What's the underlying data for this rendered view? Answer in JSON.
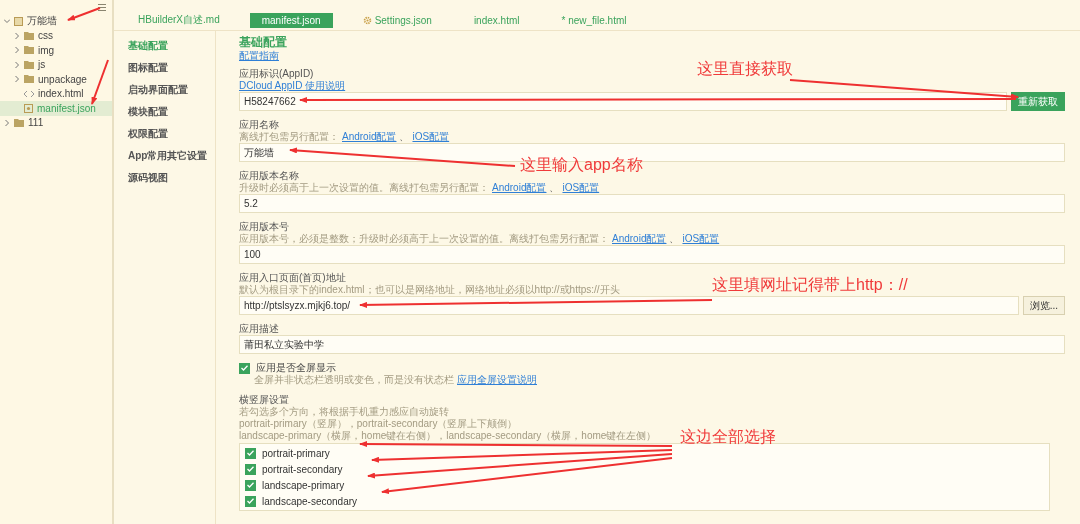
{
  "tree": [
    {
      "label": "万能墙",
      "kind": "project",
      "expanded": true,
      "selected": false,
      "children": [
        {
          "label": "css",
          "kind": "folder",
          "expanded": false,
          "selected": false
        },
        {
          "label": "img",
          "kind": "folder",
          "expanded": false,
          "selected": false
        },
        {
          "label": "js",
          "kind": "folder",
          "expanded": false,
          "selected": false
        },
        {
          "label": "unpackage",
          "kind": "folder",
          "expanded": false,
          "selected": false
        },
        {
          "label": "index.html",
          "kind": "html",
          "selected": false
        },
        {
          "label": "manifest.json",
          "kind": "json",
          "selected": true
        }
      ]
    },
    {
      "label": "111",
      "kind": "folder",
      "expanded": false,
      "selected": false
    }
  ],
  "tabs": [
    {
      "label": "HBuilderX自述.md",
      "selected": false,
      "kind": "file"
    },
    {
      "label": "manifest.json",
      "selected": true,
      "kind": "file"
    },
    {
      "label": "Settings.json",
      "selected": false,
      "kind": "settings"
    },
    {
      "label": "index.html",
      "selected": false,
      "kind": "file"
    },
    {
      "label": "* new_file.html",
      "selected": false,
      "kind": "file"
    }
  ],
  "menu": [
    {
      "label": "基础配置",
      "selected": true
    },
    {
      "label": "图标配置",
      "selected": false
    },
    {
      "label": "启动界面配置",
      "selected": false
    },
    {
      "label": "模块配置",
      "selected": false
    },
    {
      "label": "权限配置",
      "selected": false
    },
    {
      "label": "App常用其它设置",
      "selected": false
    },
    {
      "label": "源码视图",
      "selected": false
    }
  ],
  "section": {
    "title": "基础配置",
    "link": "配置指南"
  },
  "fields": [
    {
      "kind": "input",
      "label": "应用标识(AppID)",
      "links": [
        "DCloud AppID 使用说明"
      ],
      "value": "H58247662",
      "button": "重新获取"
    },
    {
      "kind": "input",
      "label": "应用名称",
      "hint": "离线打包需另行配置：",
      "links": [
        "Android配置",
        "iOS配置"
      ],
      "separator": "、",
      "value": "万能墙"
    },
    {
      "kind": "input",
      "label": "应用版本名称",
      "hint": "升级时必须高于上一次设置的值。离线打包需另行配置：",
      "links": [
        "Android配置",
        "iOS配置"
      ],
      "separator": "、",
      "value": "5.2"
    },
    {
      "kind": "input",
      "label": "应用版本号",
      "hint": "应用版本号，必须是整数；升级时必须高于上一次设置的值。离线打包需另行配置：",
      "links": [
        "Android配置",
        "iOS配置"
      ],
      "separator": "、",
      "value": "100"
    },
    {
      "kind": "input",
      "label": "应用入口页面(首页)地址",
      "hint": "默认为根目录下的index.html；也可以是网络地址，网络地址必须以http://或https://开头",
      "value": "http://ptslsyzx.mjkj6.top/",
      "button": "浏览..."
    },
    {
      "kind": "input",
      "label": "应用描述",
      "value": "莆田私立实验中学"
    },
    {
      "kind": "checkbox",
      "label": "应用是否全屏显示",
      "checked": true,
      "hint": "全屏并非状态栏透明或变色，而是没有状态栏",
      "links": [
        "应用全屏设置说明"
      ]
    },
    {
      "kind": "checklist",
      "label": "横竖屏设置",
      "hints": [
        "若勾选多个方向，将根据手机重力感应自动旋转",
        "portrait-primary（竖屏），portrait-secondary（竖屏上下颠倒）",
        "landscape-primary（横屏，home键在右侧），landscape-secondary（横屏，home键在左侧）"
      ],
      "options": [
        {
          "label": "portrait-primary",
          "checked": true
        },
        {
          "label": "portrait-secondary",
          "checked": true
        },
        {
          "label": "landscape-primary",
          "checked": true
        },
        {
          "label": "landscape-secondary",
          "checked": true
        }
      ]
    }
  ],
  "annotations": [
    "这里直接获取",
    "这里输入app名称",
    "这里填网址记得带上http：//",
    "这边全部选择"
  ]
}
